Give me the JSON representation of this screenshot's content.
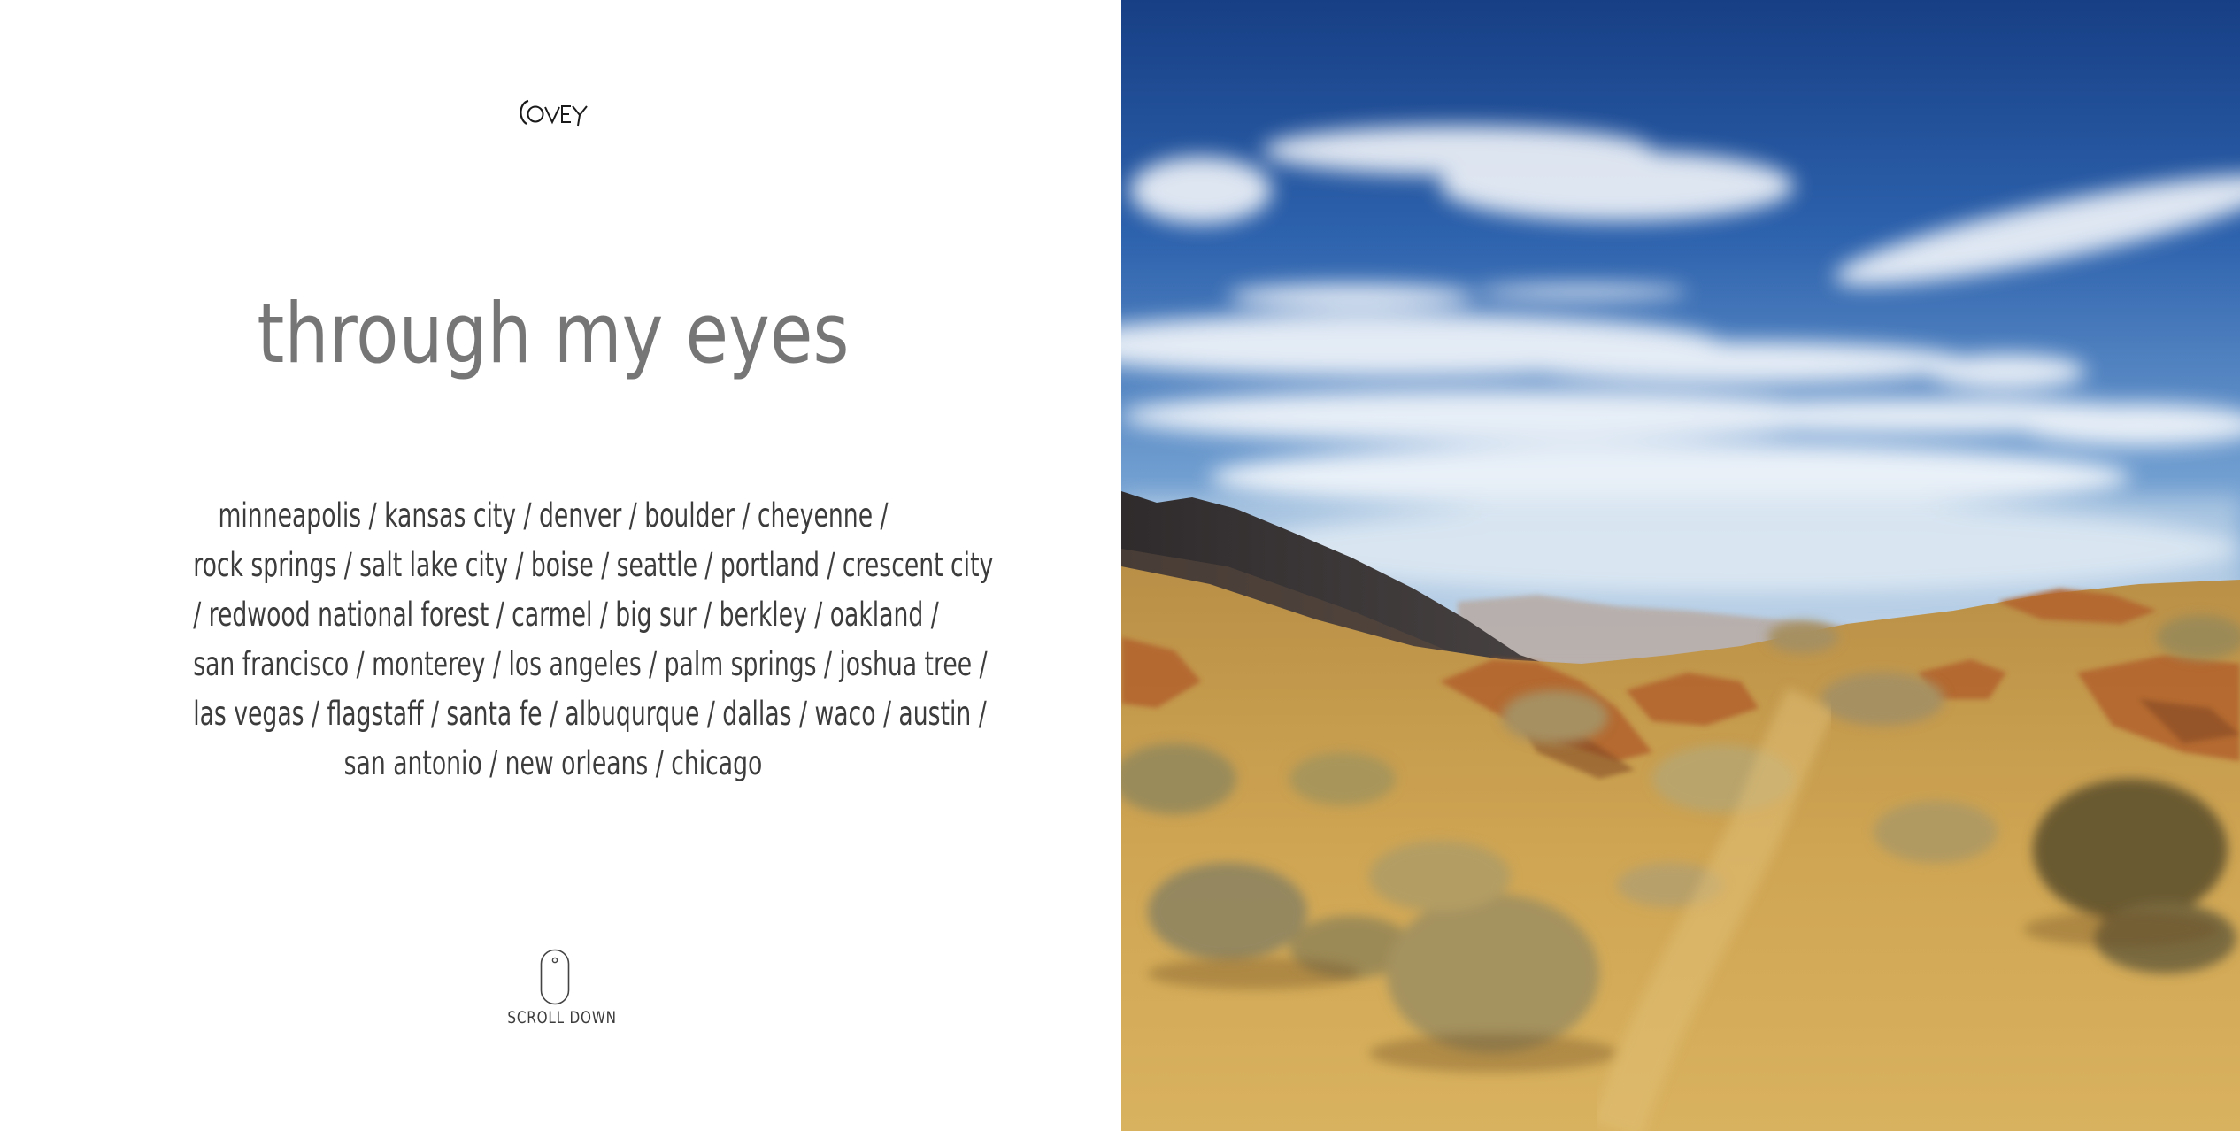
{
  "brand": {
    "logo_text": "COVEY",
    "logo_icon": "covey-logo"
  },
  "hero": {
    "title": "through my eyes",
    "places_lines": [
      "minneapolis / kansas city / denver / boulder / cheyenne /",
      "rock springs / salt lake city / boise / seattle / portland / crescent city",
      "/ redwood national forest / carmel / big sur / berkley / oakland /",
      "san francisco / monterey / los angeles / palm springs / joshua tree /",
      "las vegas / flagstaff / santa fe / albuqurque / dallas / waco / austin /",
      "san antonio / new orleans / chicago"
    ]
  },
  "scroll": {
    "label": "SCROLL DOWN",
    "icon": "mouse-icon"
  },
  "photo": {
    "subject": "desert-landscape-image",
    "colors": {
      "sky_top": "#1d4f96",
      "sky_mid": "#4f86c4",
      "sky_low": "#a9c6e2",
      "mountain": "#3e3a3a",
      "sand": "#c9a04e",
      "rock": "#b86a33",
      "brush": "#8c7a45"
    }
  }
}
